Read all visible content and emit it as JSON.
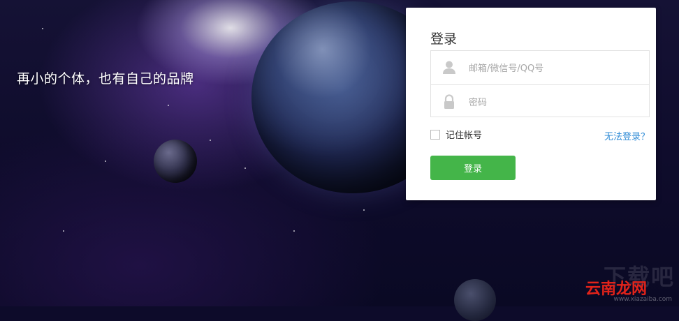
{
  "slogan": "再小的个体，也有自己的品牌",
  "login": {
    "title": "登录",
    "username_placeholder": "邮箱/微信号/QQ号",
    "password_placeholder": "密码",
    "remember_label": "记住帐号",
    "forgot_link": "无法登录？",
    "submit_label": "登录"
  },
  "watermark": {
    "big": "下载吧",
    "brand": "云南龙网",
    "url": "www.xiazaiba.com"
  },
  "icons": {
    "username": "user-icon",
    "password": "lock-icon"
  },
  "colors": {
    "accent_button": "#44b549",
    "link": "#2f8bd6",
    "watermark_brand": "#e2231a"
  }
}
